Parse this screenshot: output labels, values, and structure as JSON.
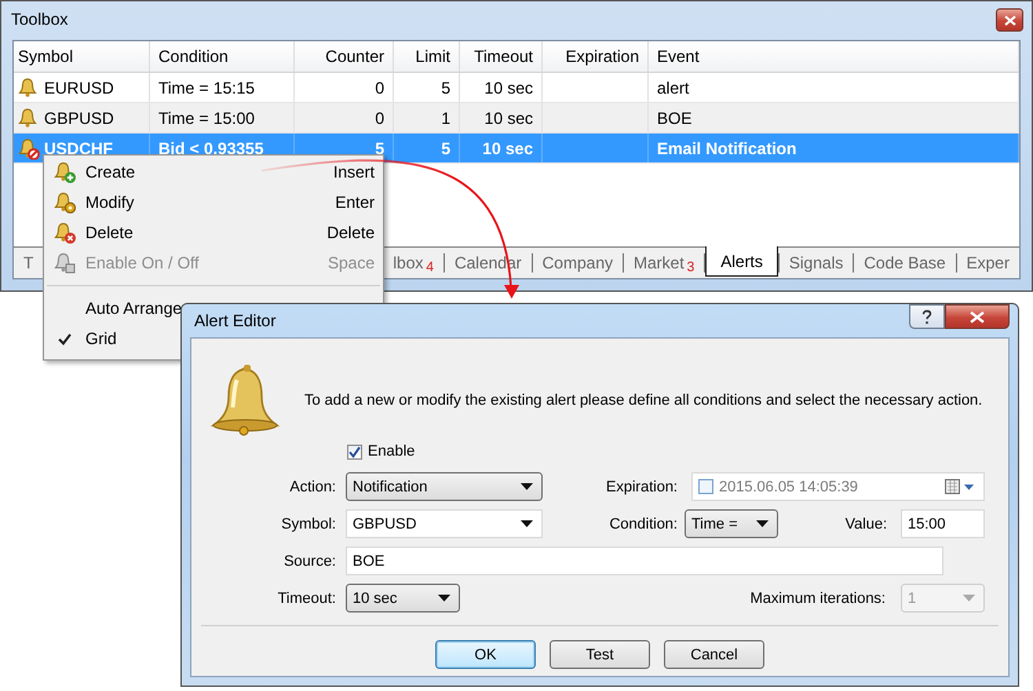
{
  "toolbox": {
    "title": "Toolbox",
    "columns": [
      "Symbol",
      "Condition",
      "Counter",
      "Limit",
      "Timeout",
      "Expiration",
      "Event"
    ],
    "rows": [
      {
        "symbol": "EURUSD",
        "condition": "Time = 15:15",
        "counter": "0",
        "limit": "5",
        "timeout": "10 sec",
        "event": "alert",
        "enabled": true,
        "selected": false
      },
      {
        "symbol": "GBPUSD",
        "condition": "Time = 15:00",
        "counter": "0",
        "limit": "1",
        "timeout": "10 sec",
        "event": "BOE",
        "enabled": true,
        "selected": false
      },
      {
        "symbol": "USDCHF",
        "condition": "Bid < 0.93355",
        "counter": "5",
        "limit": "5",
        "timeout": "10 sec",
        "event": "Email Notification",
        "enabled": false,
        "selected": true
      }
    ],
    "tabs": [
      {
        "label": "T",
        "selected": false
      },
      {
        "label": "lbox",
        "badge": "4",
        "selected": false
      },
      {
        "label": "Calendar",
        "selected": false
      },
      {
        "label": "Company",
        "selected": false
      },
      {
        "label": "Market",
        "badge": "3",
        "selected": false
      },
      {
        "label": "Alerts",
        "selected": true
      },
      {
        "label": "Signals",
        "selected": false
      },
      {
        "label": "Code Base",
        "selected": false
      },
      {
        "label": "Exper",
        "selected": false
      }
    ]
  },
  "context_menu": {
    "items": [
      {
        "kind": "create",
        "label": "Create",
        "shortcut": "Insert",
        "disabled": false
      },
      {
        "kind": "modify",
        "label": "Modify",
        "shortcut": "Enter",
        "disabled": false
      },
      {
        "kind": "delete",
        "label": "Delete",
        "shortcut": "Delete",
        "disabled": false
      },
      {
        "kind": "toggle",
        "label": "Enable On / Off",
        "shortcut": "Space",
        "disabled": true
      },
      {
        "kind": "separator"
      },
      {
        "kind": "plain",
        "label": "Auto Arrange",
        "checked": false,
        "disabled": false
      },
      {
        "kind": "plain",
        "label": "Grid",
        "checked": true,
        "disabled": false
      }
    ]
  },
  "dialog": {
    "title": "Alert Editor",
    "message": "To add a new or modify the existing alert please define all conditions and select the necessary action.",
    "enable": {
      "label": "Enable",
      "checked": true
    },
    "rows": [
      [
        {
          "kind": "select",
          "label": "Action:",
          "value": "Notification"
        },
        {
          "kind": "date",
          "label": "Expiration:",
          "value": "2015.06.05 14:05:39",
          "checked": false
        }
      ],
      [
        {
          "kind": "combo",
          "label": "Symbol:",
          "value": "GBPUSD"
        },
        {
          "kind": "select",
          "label": "Condition:",
          "value": "Time ="
        },
        {
          "kind": "text",
          "label": "Value:",
          "value": "15:00"
        }
      ],
      [
        {
          "kind": "text",
          "label": "Source:",
          "value": "BOE"
        }
      ],
      [
        {
          "kind": "select",
          "label": "Timeout:",
          "value": "10 sec"
        },
        {
          "kind": "select",
          "label": "Maximum iterations:",
          "value": "1",
          "disabled": true
        }
      ]
    ],
    "buttons": [
      {
        "label": "OK",
        "default": true
      },
      {
        "label": "Test",
        "default": false
      },
      {
        "label": "Cancel",
        "default": false
      }
    ]
  }
}
